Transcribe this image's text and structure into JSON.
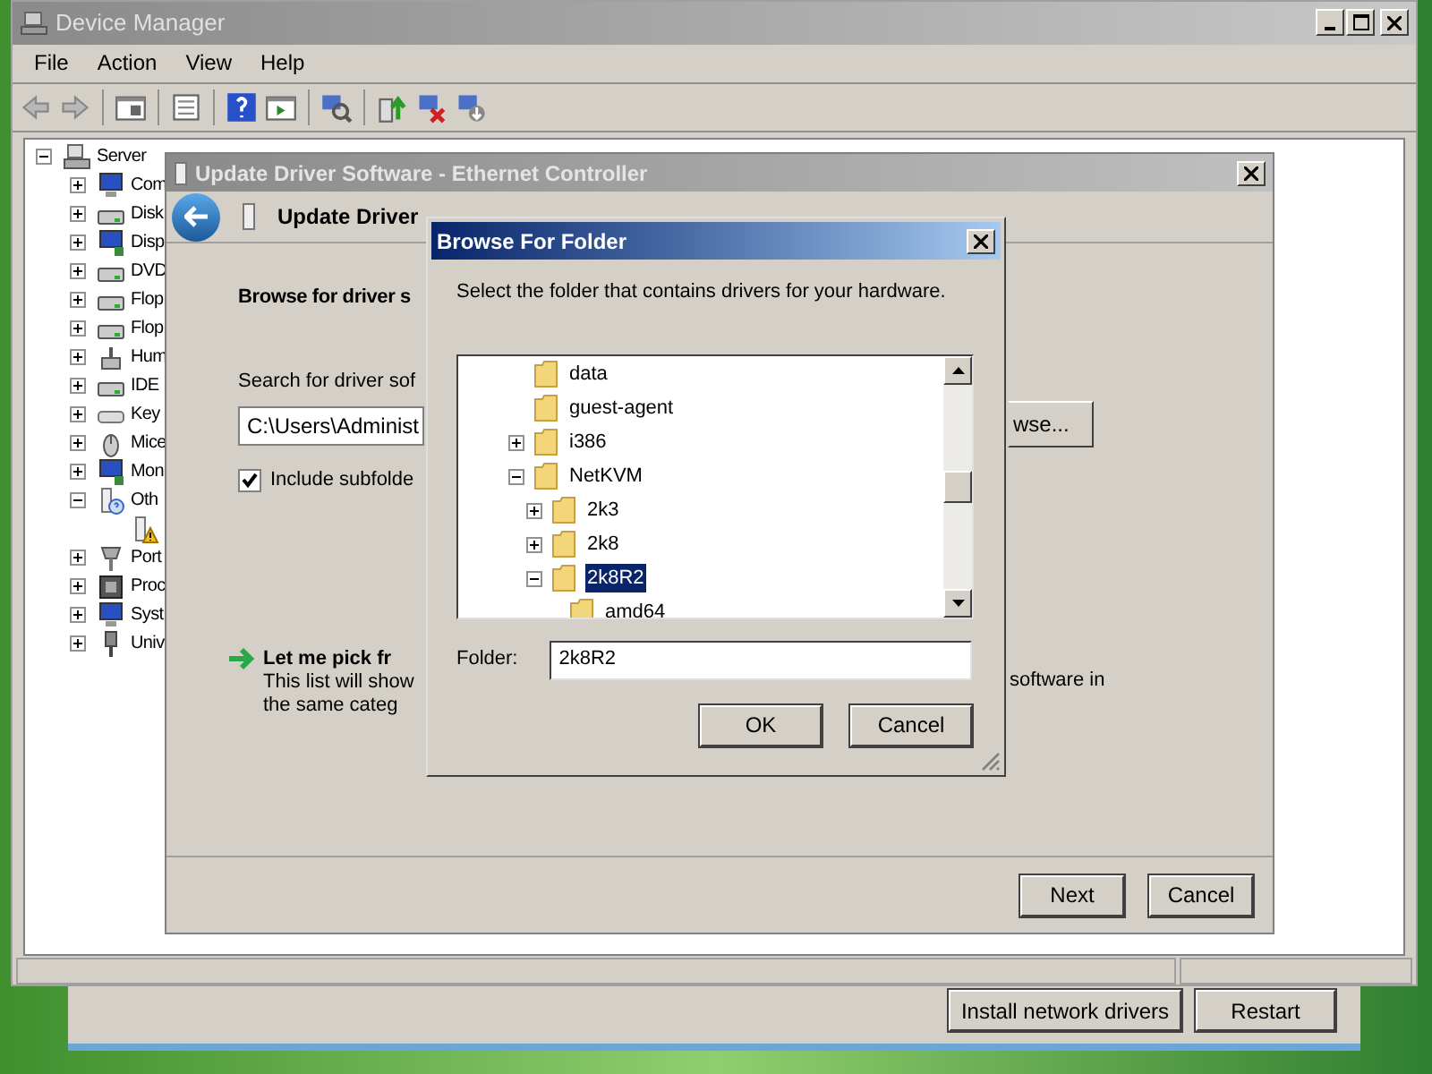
{
  "background_window": {
    "buttons": [
      "Install network drivers",
      "Restart"
    ]
  },
  "window": {
    "title": "Device Manager",
    "menu": [
      "File",
      "Action",
      "View",
      "Help"
    ],
    "tree": {
      "label": "Server",
      "expanded": true,
      "children": [
        {
          "label": "Com",
          "kind": "computer",
          "expanded": false
        },
        {
          "label": "Disk",
          "kind": "disk",
          "expanded": false
        },
        {
          "label": "Disp",
          "kind": "display",
          "expanded": false
        },
        {
          "label": "DVD",
          "kind": "disk",
          "expanded": false
        },
        {
          "label": "Flop",
          "kind": "disk",
          "expanded": false
        },
        {
          "label": "Flop",
          "kind": "disk",
          "expanded": false
        },
        {
          "label": "Hum",
          "kind": "hid",
          "expanded": false
        },
        {
          "label": "IDE",
          "kind": "disk",
          "expanded": false
        },
        {
          "label": "Key",
          "kind": "keyboard",
          "expanded": false
        },
        {
          "label": "Mice",
          "kind": "mouse",
          "expanded": false
        },
        {
          "label": "Mon",
          "kind": "display",
          "expanded": false
        },
        {
          "label": "Oth",
          "kind": "other",
          "expanded": true,
          "children": [
            {
              "kind": "warning"
            }
          ]
        },
        {
          "label": "Port",
          "kind": "port",
          "expanded": false
        },
        {
          "label": "Proc",
          "kind": "processor",
          "expanded": false
        },
        {
          "label": "Syst",
          "kind": "computer",
          "expanded": false
        },
        {
          "label": "Univ",
          "kind": "usb",
          "expanded": false
        }
      ]
    }
  },
  "update_dialog": {
    "title": "Update Driver Software - Ethernet Controller",
    "header": "Update Driver",
    "heading": "Browse for driver s",
    "search_label": "Search for driver sof",
    "path_value": "C:\\Users\\Administ",
    "browse_button": "wse...",
    "include_subfolders": {
      "label": "Include subfolde",
      "checked": true
    },
    "pick": {
      "title": "Let me pick fr",
      "line_1": "This list will show",
      "line_1_end": "software in",
      "line_2": "the same categ"
    },
    "buttons": [
      "Next",
      "Cancel"
    ]
  },
  "browse_dialog": {
    "title": "Browse For Folder",
    "instruction": "Select the folder that contains drivers for your hardware.",
    "folders": [
      {
        "label": "data",
        "selected": false
      },
      {
        "label": "guest-agent",
        "selected": false
      },
      {
        "label": "i386",
        "selected": false,
        "expanded": false
      },
      {
        "label": "NetKVM",
        "selected": false,
        "expanded": true,
        "children": [
          {
            "label": "2k3",
            "selected": false,
            "expanded": false
          },
          {
            "label": "2k8",
            "selected": false,
            "expanded": false
          },
          {
            "label": "2k8R2",
            "selected": true,
            "expanded": true,
            "children": [
              {
                "label": "amd64",
                "selected": false
              }
            ]
          }
        ]
      }
    ],
    "folder_label": "Folder:",
    "folder_value": "2k8R2",
    "buttons": [
      "OK",
      "Cancel"
    ]
  }
}
